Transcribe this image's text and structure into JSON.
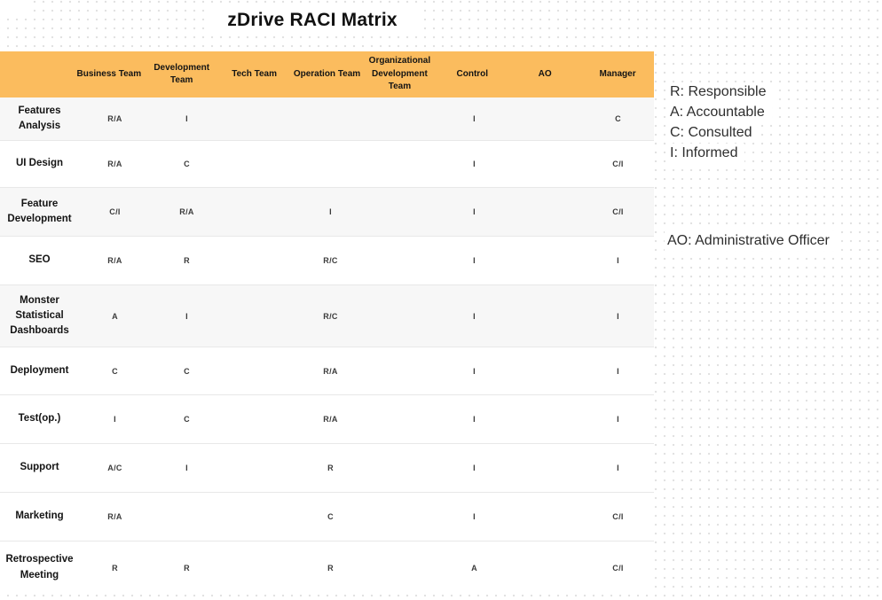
{
  "title": "zDrive RACI Matrix",
  "legend": {
    "items": [
      "R: Responsible",
      "A: Accountable",
      "C: Consulted",
      "I: Informed"
    ],
    "note": "AO: Administrative Officer"
  },
  "table": {
    "columns": [
      "",
      "Business Team",
      "Development Team",
      "Tech Team",
      "Operation Team",
      "Organizational Development Team",
      "Control",
      "AO",
      "Manager"
    ],
    "rows": [
      {
        "label": "Features Analysis",
        "cells": [
          "R/A",
          "I",
          "",
          "",
          "",
          "I",
          "",
          "C"
        ]
      },
      {
        "label": "UI Design",
        "cells": [
          "R/A",
          "C",
          "",
          "",
          "",
          "I",
          "",
          "C/I"
        ]
      },
      {
        "label": "Feature Development",
        "cells": [
          "C/I",
          "R/A",
          "",
          "I",
          "",
          "I",
          "",
          "C/I"
        ]
      },
      {
        "label": "SEO",
        "cells": [
          "R/A",
          "R",
          "",
          "R/C",
          "",
          "I",
          "",
          "I"
        ]
      },
      {
        "label": "Monster Statistical Dashboards",
        "cells": [
          "A",
          "I",
          "",
          "R/C",
          "",
          "I",
          "",
          "I"
        ]
      },
      {
        "label": "Deployment",
        "cells": [
          "C",
          "C",
          "",
          "R/A",
          "",
          "I",
          "",
          "I"
        ]
      },
      {
        "label": "Test(op.)",
        "cells": [
          "I",
          "C",
          "",
          "R/A",
          "",
          "I",
          "",
          "I"
        ]
      },
      {
        "label": "Support",
        "cells": [
          "A/C",
          "I",
          "",
          "R",
          "",
          "I",
          "",
          "I"
        ]
      },
      {
        "label": "Marketing",
        "cells": [
          "R/A",
          "",
          "",
          "C",
          "",
          "I",
          "",
          "C/I"
        ]
      },
      {
        "label": "Retrospective Meeting",
        "cells": [
          "R",
          "R",
          "",
          "R",
          "",
          "A",
          "",
          "C/I"
        ]
      }
    ]
  },
  "colors": {
    "header_bg": "#FBBC5E",
    "row_alt_bg": "#F7F7F7",
    "row_border": "#E8E8E8",
    "dot_grid": "#E2E2E2",
    "text_primary": "#141414",
    "text_cell": "#3B3B3B"
  }
}
